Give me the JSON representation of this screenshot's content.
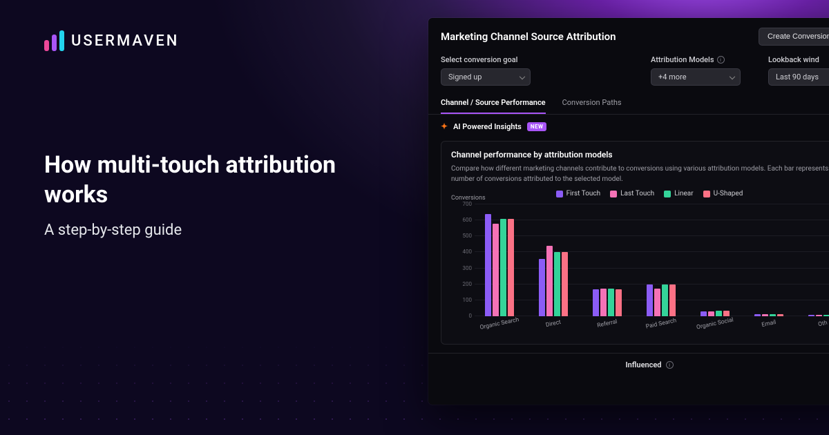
{
  "logo_text": "USERMAVEN",
  "headline": {
    "title": "How multi-touch attribution works",
    "subtitle": "A step-by-step guide"
  },
  "app": {
    "title": "Marketing Channel Source Attribution",
    "create_goal_btn": "Create Conversion Goal",
    "controls": {
      "goal_label": "Select conversion goal",
      "goal_value": "Signed up",
      "models_label": "Attribution Models",
      "models_value": "+4 more",
      "lookback_label": "Lookback wind",
      "lookback_value": "Last 90 days"
    },
    "tabs": {
      "perf": "Channel / Source Performance",
      "paths": "Conversion Paths"
    },
    "insights_label": "AI Powered Insights",
    "insights_badge": "NEW",
    "card_title": "Channel performance by attribution models",
    "card_desc": "Compare how different marketing channels contribute to conversions using various attribution models. Each bar represents the number of conversions attributed to the selected model.",
    "influenced_label": "Influenced"
  },
  "chart_data": {
    "type": "bar",
    "ylabel": "Conversions",
    "ylim": [
      0,
      700
    ],
    "yticks": [
      0,
      100,
      200,
      300,
      400,
      500,
      600,
      700
    ],
    "categories": [
      "Organic Search",
      "Direct",
      "Referral",
      "Paid Search",
      "Organic Social",
      "Email",
      "Oth"
    ],
    "series": [
      {
        "name": "First Touch",
        "color": "#8b5cf6",
        "values": [
          640,
          360,
          170,
          200,
          30,
          15,
          10
        ]
      },
      {
        "name": "Last Touch",
        "color": "#f472b6",
        "values": [
          580,
          440,
          175,
          175,
          30,
          15,
          10
        ]
      },
      {
        "name": "Linear",
        "color": "#34d399",
        "values": [
          610,
          400,
          175,
          200,
          33,
          15,
          10
        ]
      },
      {
        "name": "U-Shaped",
        "color": "#fb7185",
        "values": [
          610,
          400,
          170,
          200,
          33,
          15,
          10
        ]
      }
    ]
  }
}
